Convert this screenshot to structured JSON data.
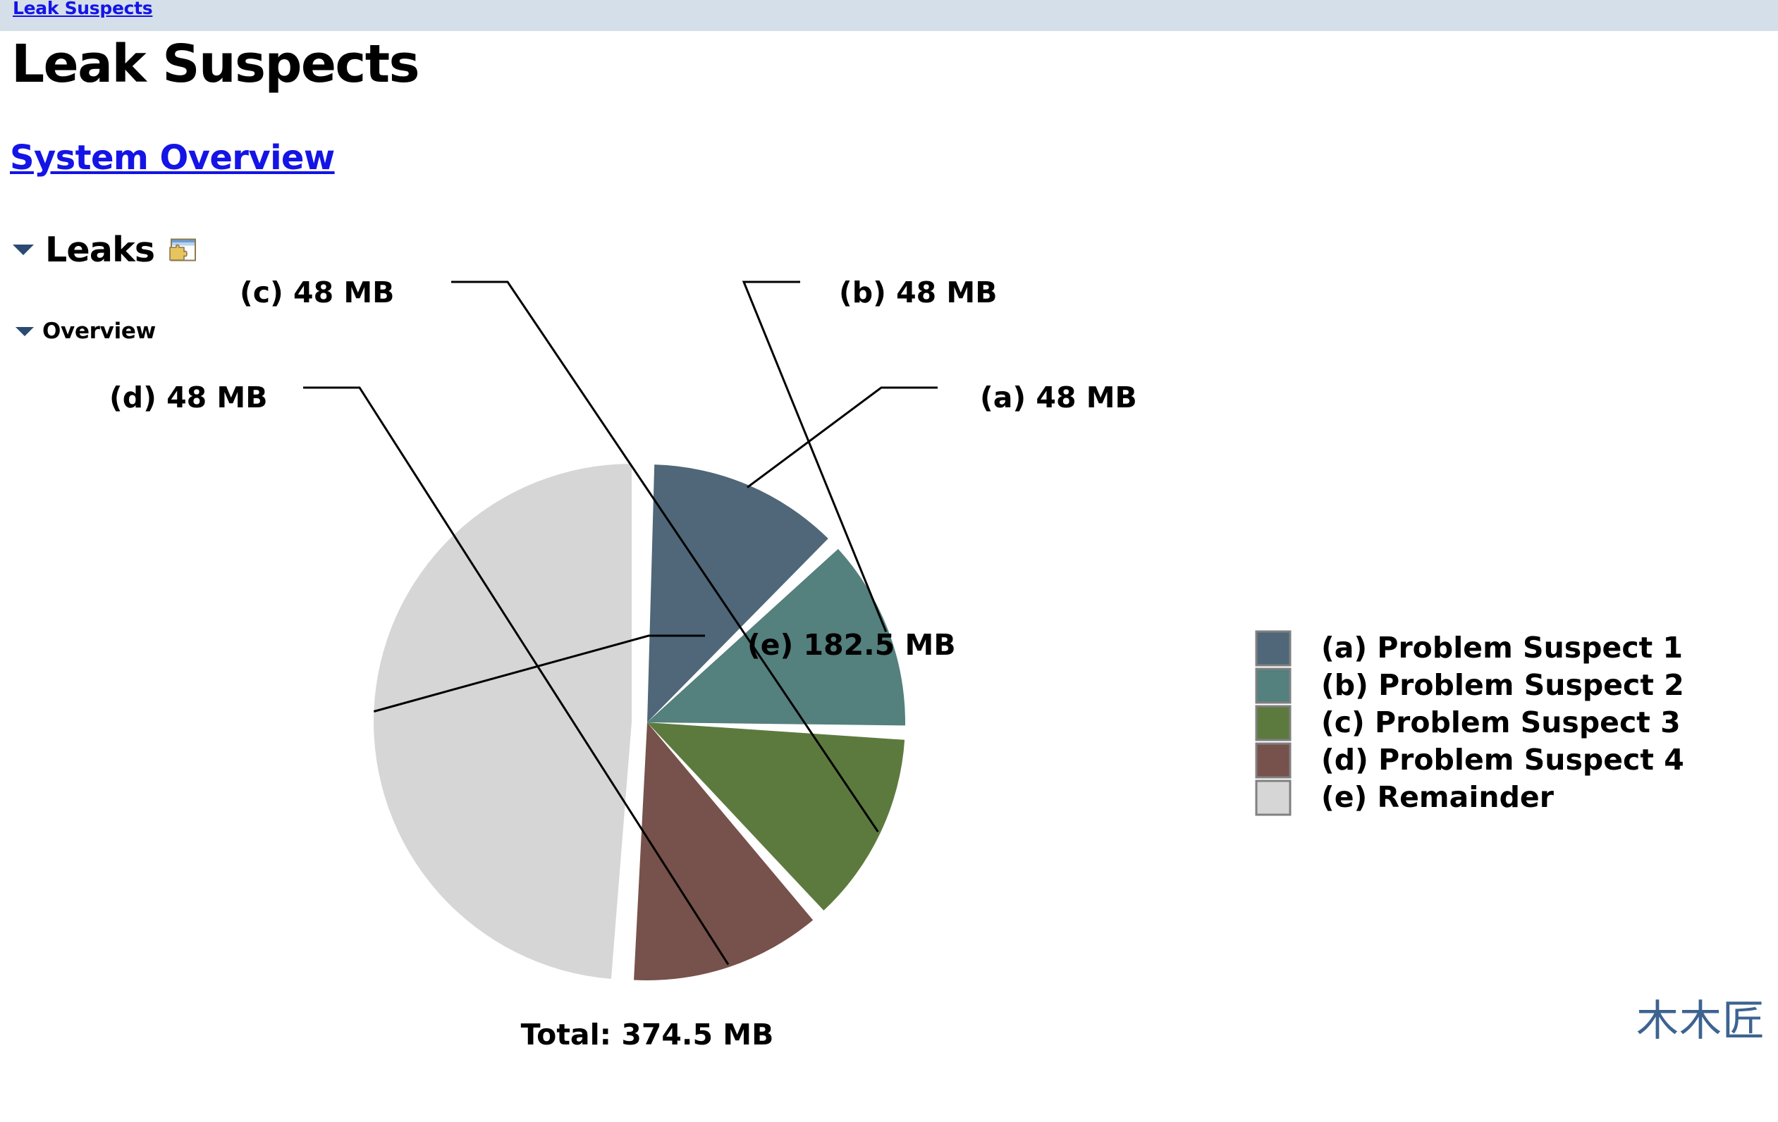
{
  "breadcrumb": {
    "link_label": "Leak Suspects"
  },
  "page_title": "Leak Suspects",
  "system_overview_link": "System Overview",
  "sections": {
    "leaks": {
      "label": "Leaks",
      "icon": "window-puzzle-icon",
      "expanded_icon": "chevron-down-icon"
    },
    "overview": {
      "label": "Overview",
      "expanded_icon": "chevron-down-icon"
    }
  },
  "watermark": "木木匠",
  "colors": {
    "breadcrumb_background": "#d4dfe9",
    "link": "#1414e6",
    "triangle": "#2b4a72",
    "watermark": "#3d6390"
  },
  "chart_data": {
    "type": "pie",
    "title": "",
    "total_label": "Total: 374.5 MB",
    "total_value": 374.5,
    "unit": "MB",
    "categories": [
      "(a) Problem Suspect 1",
      "(b) Problem Suspect 2",
      "(c) Problem Suspect 3",
      "(d) Problem Suspect 4",
      "(e) Remainder"
    ],
    "values": [
      48,
      48,
      48,
      48,
      182.5
    ],
    "colors": [
      "#4f6778",
      "#54807e",
      "#5c7a3d",
      "#77514b",
      "#d6d6d6"
    ],
    "legend_position": "right",
    "slices": [
      {
        "key": "a",
        "label": "(a)  48 MB",
        "legend": "(a)  Problem Suspect 1",
        "value": 48,
        "color": "#4f6778"
      },
      {
        "key": "b",
        "label": "(b)  48 MB",
        "legend": "(b)  Problem Suspect 2",
        "value": 48,
        "color": "#54807e"
      },
      {
        "key": "c",
        "label": "(c)  48 MB",
        "legend": "(c)  Problem Suspect 3",
        "value": 48,
        "color": "#5c7a3d"
      },
      {
        "key": "d",
        "label": "(d)  48 MB",
        "legend": "(d)  Problem Suspect 4",
        "value": 48,
        "color": "#77514b"
      },
      {
        "key": "e",
        "label": "(e)  182.5 MB",
        "legend": "(e)  Remainder",
        "value": 182.5,
        "color": "#d6d6d6"
      }
    ]
  }
}
